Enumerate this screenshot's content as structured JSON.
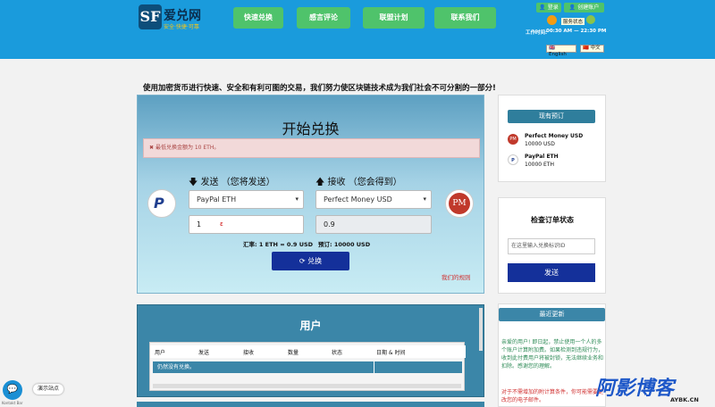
{
  "header": {
    "logo_mark": "SF",
    "logo_text": "爱兑网",
    "logo_sub": "安全·快捷·可靠",
    "nav": [
      "快速兑换",
      "感言评论",
      "联盟计划",
      "联系我们"
    ],
    "login": "登录",
    "register": "创建账户",
    "service_status": "服务状态",
    "hours_label": "工作时间:",
    "hours": "00:30 AM — 22:30 PM",
    "lang_en": "English",
    "lang_zh": "中文"
  },
  "tagline": "使用加密货币进行快速、安全和有利可图的交易，我们努力使区块链技术成为我们社会不可分割的一部分!",
  "exchange": {
    "title": "开始兑换",
    "alert": "最低兑换金额为 10 ETH。",
    "send_label": "发送 （您将发送）",
    "receive_label": "接收 （您会得到）",
    "send_select": "PayPal ETH",
    "receive_select": "Perfect Money USD",
    "send_amount": "1",
    "receive_amount": "0.9",
    "rate": "汇率: 1 ETH = 0.9 USD",
    "reserve": "预订: 10000 USD",
    "button": "兑换",
    "rules": "我们的规则"
  },
  "users": {
    "title": "用户",
    "columns": [
      "用户",
      "发送",
      "接收",
      "数量",
      "状态",
      "日期 & 时间"
    ],
    "empty": "仍然没有兑换。"
  },
  "reserves": {
    "title": "现有预订",
    "items": [
      {
        "name": "Perfect Money USD",
        "amount": "10000 USD",
        "icon": "PM"
      },
      {
        "name": "PayPal ETH",
        "amount": "10000 ETH",
        "icon": "P"
      }
    ]
  },
  "order_status": {
    "title": "检查订单状态",
    "placeholder": "在这里输入兑换标识ID",
    "button": "发送"
  },
  "news": {
    "title": "最近更新",
    "text1": "亲爱的用户! 即日起，禁止使用一个人的多个账户计算附加费。如果检测到违规行为，收到此付费用户将被封锁，无法继续业务和扣除。感谢您的理解。",
    "text2": "对于不需增加的附计算条件，你可能需要更改您的电子邮件。"
  },
  "floating": {
    "demo": "演示站点",
    "credit": "Kontakt Bar",
    "watermark_main": "阿影博客",
    "watermark_sub": "AYBK.CN"
  },
  "colors": {
    "header": "#1a9bdc",
    "nav_button": "#4fc36b",
    "primary_button": "#14309a",
    "panel_teal": "#3b86a8"
  }
}
